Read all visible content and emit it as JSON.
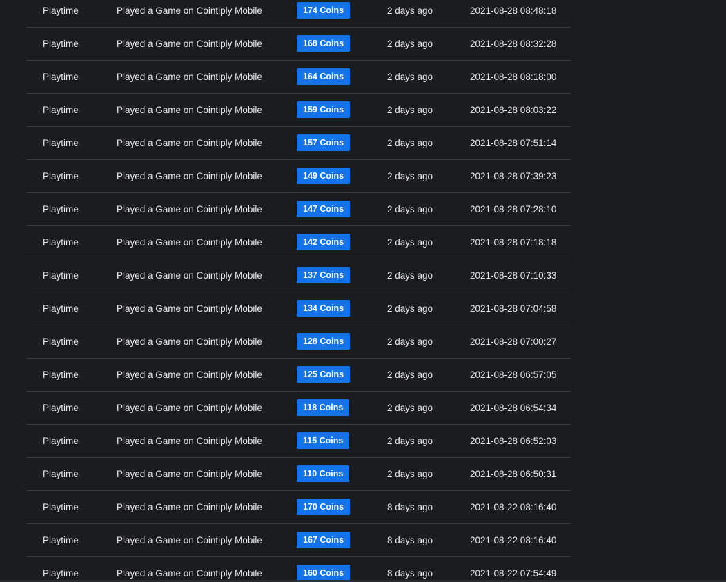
{
  "rows": [
    {
      "type": "Playtime",
      "description": "Played a Game on Cointiply Mobile",
      "amount": "174 Coins",
      "ago": "2 days ago",
      "date": "2021-08-28 08:48:18"
    },
    {
      "type": "Playtime",
      "description": "Played a Game on Cointiply Mobile",
      "amount": "168 Coins",
      "ago": "2 days ago",
      "date": "2021-08-28 08:32:28"
    },
    {
      "type": "Playtime",
      "description": "Played a Game on Cointiply Mobile",
      "amount": "164 Coins",
      "ago": "2 days ago",
      "date": "2021-08-28 08:18:00"
    },
    {
      "type": "Playtime",
      "description": "Played a Game on Cointiply Mobile",
      "amount": "159 Coins",
      "ago": "2 days ago",
      "date": "2021-08-28 08:03:22"
    },
    {
      "type": "Playtime",
      "description": "Played a Game on Cointiply Mobile",
      "amount": "157 Coins",
      "ago": "2 days ago",
      "date": "2021-08-28 07:51:14"
    },
    {
      "type": "Playtime",
      "description": "Played a Game on Cointiply Mobile",
      "amount": "149 Coins",
      "ago": "2 days ago",
      "date": "2021-08-28 07:39:23"
    },
    {
      "type": "Playtime",
      "description": "Played a Game on Cointiply Mobile",
      "amount": "147 Coins",
      "ago": "2 days ago",
      "date": "2021-08-28 07:28:10"
    },
    {
      "type": "Playtime",
      "description": "Played a Game on Cointiply Mobile",
      "amount": "142 Coins",
      "ago": "2 days ago",
      "date": "2021-08-28 07:18:18"
    },
    {
      "type": "Playtime",
      "description": "Played a Game on Cointiply Mobile",
      "amount": "137 Coins",
      "ago": "2 days ago",
      "date": "2021-08-28 07:10:33"
    },
    {
      "type": "Playtime",
      "description": "Played a Game on Cointiply Mobile",
      "amount": "134 Coins",
      "ago": "2 days ago",
      "date": "2021-08-28 07:04:58"
    },
    {
      "type": "Playtime",
      "description": "Played a Game on Cointiply Mobile",
      "amount": "128 Coins",
      "ago": "2 days ago",
      "date": "2021-08-28 07:00:27"
    },
    {
      "type": "Playtime",
      "description": "Played a Game on Cointiply Mobile",
      "amount": "125 Coins",
      "ago": "2 days ago",
      "date": "2021-08-28 06:57:05"
    },
    {
      "type": "Playtime",
      "description": "Played a Game on Cointiply Mobile",
      "amount": "118 Coins",
      "ago": "2 days ago",
      "date": "2021-08-28 06:54:34"
    },
    {
      "type": "Playtime",
      "description": "Played a Game on Cointiply Mobile",
      "amount": "115 Coins",
      "ago": "2 days ago",
      "date": "2021-08-28 06:52:03"
    },
    {
      "type": "Playtime",
      "description": "Played a Game on Cointiply Mobile",
      "amount": "110 Coins",
      "ago": "2 days ago",
      "date": "2021-08-28 06:50:31"
    },
    {
      "type": "Playtime",
      "description": "Played a Game on Cointiply Mobile",
      "amount": "170 Coins",
      "ago": "8 days ago",
      "date": "2021-08-22 08:16:40"
    },
    {
      "type": "Playtime",
      "description": "Played a Game on Cointiply Mobile",
      "amount": "167 Coins",
      "ago": "8 days ago",
      "date": "2021-08-22 08:16:40"
    },
    {
      "type": "Playtime",
      "description": "Played a Game on Cointiply Mobile",
      "amount": "160 Coins",
      "ago": "8 days ago",
      "date": "2021-08-22 07:54:49"
    }
  ],
  "colors": {
    "background": "#1b1c20",
    "row_divider": "#3a3c42",
    "badge": "#1473e6",
    "text": "#e8e8ea"
  }
}
